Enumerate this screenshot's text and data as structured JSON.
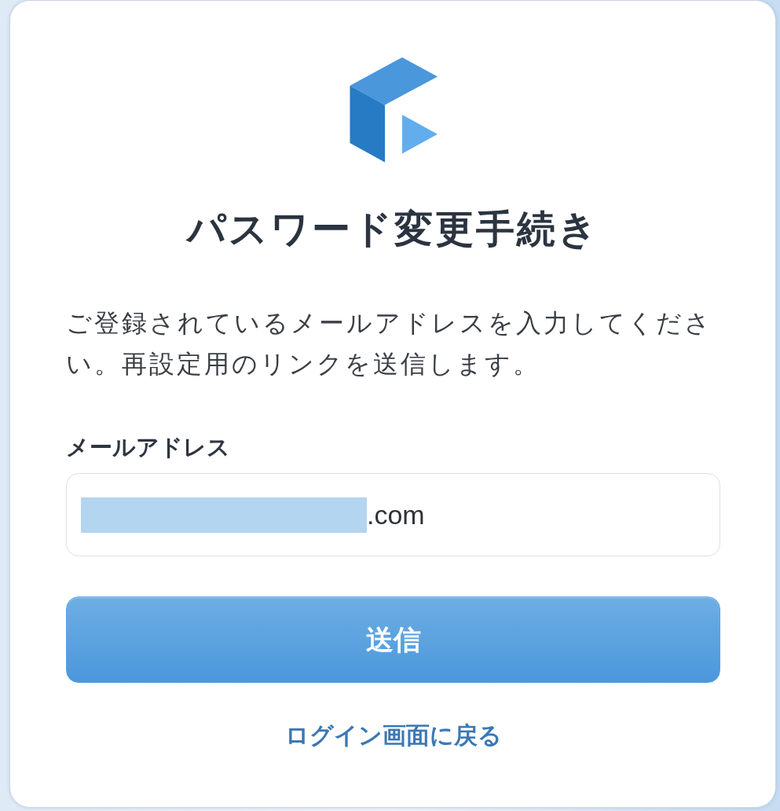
{
  "title": "パスワード変更手続き",
  "description": "ご登録されているメールアドレスを入力してください。再設定用のリンクを送信します。",
  "email_field": {
    "label": "メールアドレス",
    "value": ".com",
    "redacted": true
  },
  "submit_button": "送信",
  "back_link": "ログイン画面に戻る"
}
